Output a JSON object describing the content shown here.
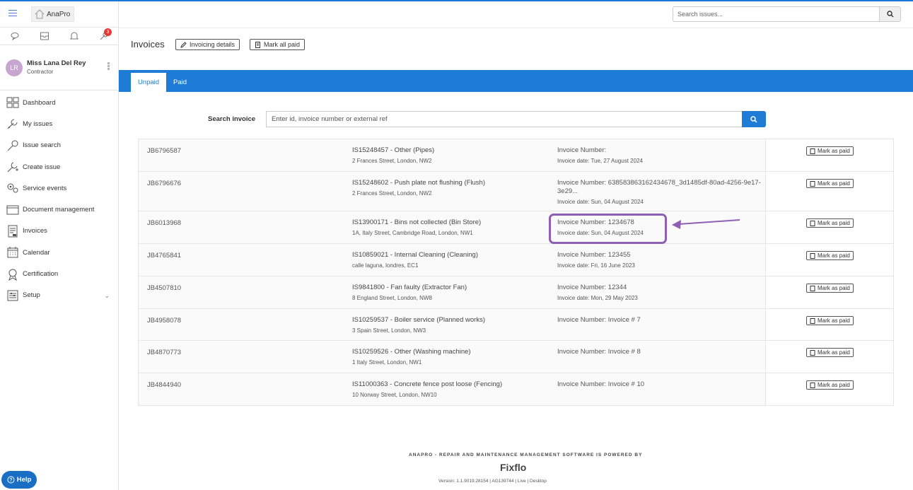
{
  "app": {
    "brand": "AnaPro"
  },
  "sidebar": {
    "notification_count": "3",
    "profile": {
      "initials": "LR",
      "name": "Miss Lana Del Rey",
      "role": "Contractor"
    },
    "items": [
      {
        "label": "Dashboard",
        "icon": "dashboard-icon"
      },
      {
        "label": "My issues",
        "icon": "wrench-icon"
      },
      {
        "label": "Issue search",
        "icon": "search-wrench-icon"
      },
      {
        "label": "Create issue",
        "icon": "create-wrench-icon"
      },
      {
        "label": "Service events",
        "icon": "gears-icon"
      },
      {
        "label": "Document management",
        "icon": "folder-icon"
      },
      {
        "label": "Invoices",
        "icon": "invoice-icon"
      },
      {
        "label": "Calendar",
        "icon": "calendar-icon"
      },
      {
        "label": "Certification",
        "icon": "certificate-icon"
      },
      {
        "label": "Setup",
        "icon": "setup-icon"
      }
    ],
    "help_label": "Help"
  },
  "header": {
    "search_placeholder": "Search issues..."
  },
  "page": {
    "title": "Invoices",
    "invoicing_details_label": "Invoicing details",
    "mark_all_paid_label": "Mark all paid"
  },
  "tabs": {
    "unpaid": "Unpaid",
    "paid": "Paid"
  },
  "search_invoice": {
    "label": "Search invoice",
    "placeholder": "Enter id, invoice number or external ref"
  },
  "invoices": [
    {
      "job": "JB6796587",
      "issue": "IS15248457 - Other (Pipes)",
      "address": "2 Frances Street, London, NW2",
      "invoice_number": "Invoice Number:",
      "invoice_date": "Invoice date: Tue, 27 August 2024",
      "action": "Mark as paid"
    },
    {
      "job": "JB6796676",
      "issue": "IS15248602 - Push plate not flushing (Flush)",
      "address": "2 Frances Street, London, NW2",
      "invoice_number": "Invoice Number: 638583863162434678_3d1485df-80ad-4256-9e17-3e29...",
      "invoice_date": "Invoice date: Sun, 04 August 2024",
      "action": "Mark as paid"
    },
    {
      "job": "JB6013968",
      "issue": "IS13900171 - Bins not collected (Bin Store)",
      "address": "1A, Italy Street, Cambridge Road, London, NW1",
      "invoice_number": "Invoice Number: 1234678",
      "invoice_date": "Invoice date: Sun, 04 August 2024",
      "action": "Mark as paid"
    },
    {
      "job": "JB4765841",
      "issue": "IS10859021 - Internal Cleaning (Cleaning)",
      "address": "calle laguna, londres, EC1",
      "invoice_number": "Invoice Number: 123455",
      "invoice_date": "Invoice date: Fri, 16 June 2023",
      "action": "Mark as paid"
    },
    {
      "job": "JB4507810",
      "issue": "IS9841800 - Fan faulty (Extractor Fan)",
      "address": "8 England Street, London, NW8",
      "invoice_number": "Invoice Number: 12344",
      "invoice_date": "Invoice date: Mon, 29 May 2023",
      "action": "Mark as paid"
    },
    {
      "job": "JB4958078",
      "issue": "IS10259537 - Boiler service (Planned works)",
      "address": "3 Spain Street, London, NW3",
      "invoice_number": "Invoice Number: Invoice # 7",
      "invoice_date": "",
      "action": "Mark as paid"
    },
    {
      "job": "JB4870773",
      "issue": "IS10259526 - Other (Washing machine)",
      "address": "1 Italy Street, London, NW1",
      "invoice_number": "Invoice Number: Invoice # 8",
      "invoice_date": "",
      "action": "Mark as paid"
    },
    {
      "job": "JB4844940",
      "issue": "IS11000363 - Concrete fence post loose (Fencing)",
      "address": "10 Norway Street, London, NW10",
      "invoice_number": "Invoice Number: Invoice # 10",
      "invoice_date": "",
      "action": "Mark as paid"
    }
  ],
  "footer": {
    "powered": "ANAPRO - REPAIR AND MAINTENANCE MANAGEMENT SOFTWARE IS POWERED BY",
    "brand": "Fixflo",
    "version": "Version: 1.1.9019.28154   |   AG139744   |   Live   |   Desktop"
  },
  "colors": {
    "accent": "#1e7cd6",
    "highlight": "#8e5fb3",
    "badge": "#e53935"
  }
}
